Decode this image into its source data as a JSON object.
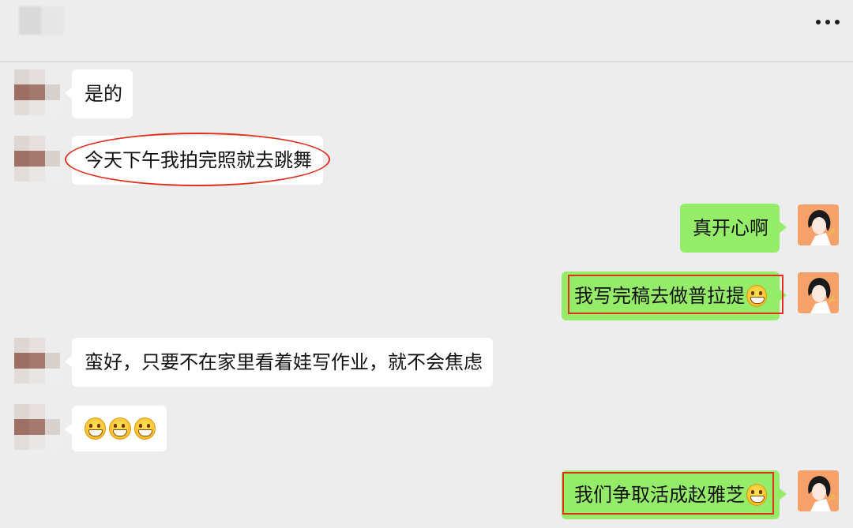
{
  "header": {
    "more_icon": "more-icon"
  },
  "messages": [
    {
      "side": "left",
      "text": "是的"
    },
    {
      "side": "left",
      "text": "今天下午我拍完照就去跳舞"
    },
    {
      "side": "right",
      "text": "真开心啊"
    },
    {
      "side": "right",
      "text": "我写完稿去做普拉提",
      "emoji": "grinning-emoji"
    },
    {
      "side": "left",
      "text": "蛮好，只要不在家里看着娃写作业，就不会焦虑"
    },
    {
      "side": "left",
      "emoji_count": 3,
      "emoji": "grinning-emoji"
    },
    {
      "side": "right",
      "text": "我们争取活成赵雅芝",
      "emoji": "grinning-emoji"
    }
  ],
  "colors": {
    "background": "#ededed",
    "right_bubble": "#95ec69",
    "left_bubble": "#ffffff",
    "annotation": "#e0301e"
  }
}
